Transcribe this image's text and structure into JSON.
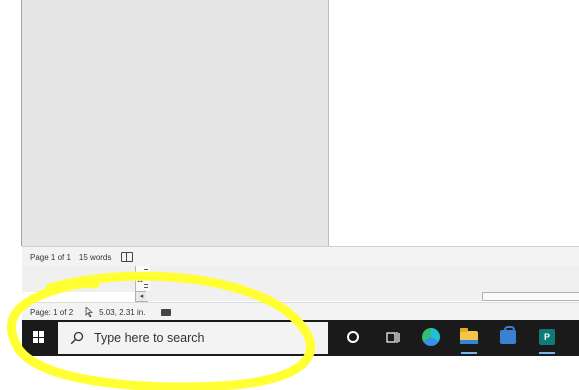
{
  "word_window": {
    "status": {
      "page": "Page 1 of 1",
      "words": "15 words",
      "proofing_icon": "book-icon"
    },
    "ruler": {
      "number": "11"
    },
    "scroll_left_glyph": "◂"
  },
  "publisher_window": {
    "status": {
      "page": "Page: 1 of 2",
      "cursor_icon": "cursor-icon",
      "coords": "5.03, 2.31 in.",
      "macro_icon": "macro-icon"
    }
  },
  "taskbar": {
    "start_icon": "windows-icon",
    "search_placeholder": "Type here to search",
    "icons": [
      "cortana-icon",
      "task-view-icon",
      "edge-icon",
      "file-explorer-icon",
      "store-icon",
      "publisher-icon"
    ],
    "publisher_letter": "P"
  },
  "annotation_color": "#ffff33"
}
